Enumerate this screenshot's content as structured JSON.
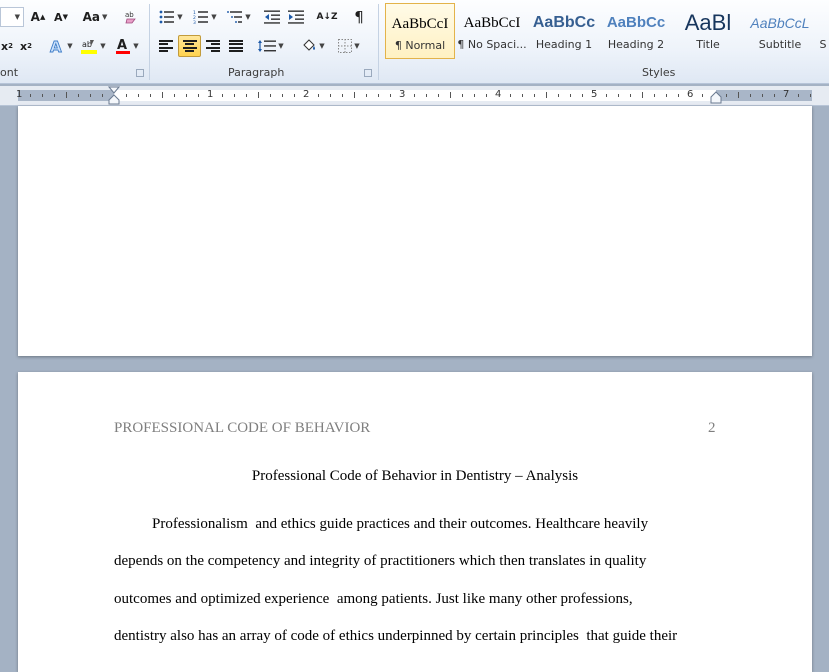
{
  "ribbon": {
    "font_group_label": "ont",
    "paragraph_group_label": "Paragraph",
    "styles_group_label": "Styles",
    "change_case_label": "Aa",
    "pilcrow": "¶",
    "sort_label": "A↓Z",
    "styles": [
      {
        "preview": "AaBbCcI",
        "name": "¶ Normal",
        "selected": true
      },
      {
        "preview": "AaBbCcI",
        "name": "¶ No Spaci..."
      },
      {
        "preview": "AaBbCc",
        "name": "Heading 1"
      },
      {
        "preview": "AaBbCc",
        "name": "Heading 2"
      },
      {
        "preview": "AaBl",
        "name": "Title"
      },
      {
        "preview": "AaBbCcL",
        "name": "Subtitle"
      },
      {
        "preview": "",
        "name": "S"
      }
    ]
  },
  "ruler": {
    "numbers": [
      "1",
      "1",
      "2",
      "3",
      "4",
      "5",
      "6",
      "7"
    ]
  },
  "document": {
    "page2": {
      "header_text": "PROFESSIONAL CODE OF BEHAVIOR",
      "page_number": "2",
      "title": "Professional Code of Behavior in Dentistry – Analysis",
      "lines": [
        "Professionalism  and ethics guide practices and their outcomes. Healthcare heavily",
        "depends on the competency and integrity of practitioners which then translates in quality",
        "outcomes and optimized experience  among patients. Just like many other professions,",
        "dentistry also has an array of code of ethics underpinned by certain principles  that guide their"
      ]
    }
  },
  "colors": {
    "workspace": "#a4b2c4",
    "highlight": "#ffff00",
    "font_color": "#ff0000",
    "selected_style_border": "#e3b34a",
    "heading_blue": "#365f91"
  }
}
